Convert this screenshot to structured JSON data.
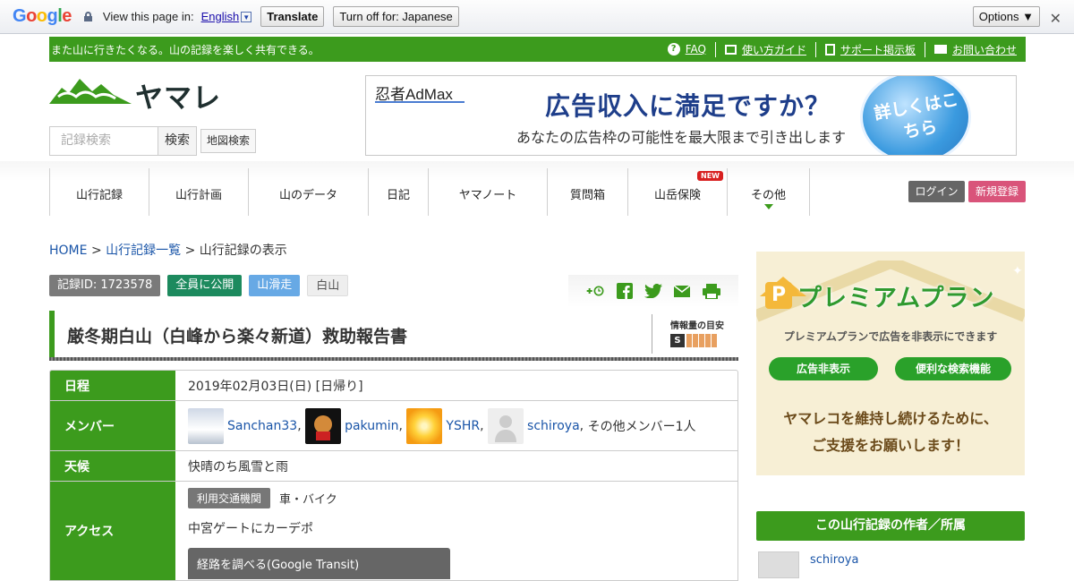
{
  "translate_bar": {
    "logo": "Google",
    "prompt": "View this page in:",
    "language": "English",
    "translate_label": "Translate",
    "turnoff_label": "Turn off for: Japanese",
    "options_label": "Options ▼",
    "close": "✕"
  },
  "header": {
    "tagline": "また山に行きたくなる。山の記録を楽しく共有できる。",
    "links": [
      "FAQ",
      "使い方ガイド",
      "サポート掲示板",
      "お問い合わせ"
    ],
    "logo_text": "ヤマレコ",
    "search_placeholder": "記録検索",
    "search_button": "検索",
    "map_search": "地図検索"
  },
  "ad_banner": {
    "brand": "忍者AdMax",
    "headline": "広告収入に満足ですか？",
    "subline": "あなたの広告枠の可能性を最大限まで引き出します",
    "cta": "詳しくはこちら"
  },
  "nav": {
    "items": [
      {
        "label": "山行記録"
      },
      {
        "label": "山行計画"
      },
      {
        "label": "山のデータ"
      },
      {
        "label": "日記"
      },
      {
        "label": "ヤマノート"
      },
      {
        "label": "質問箱"
      },
      {
        "label": "山岳保険",
        "badge": "NEW"
      },
      {
        "label": "その他"
      }
    ],
    "login": "ログイン",
    "signup": "新規登録"
  },
  "breadcrumb": {
    "home": "HOME",
    "list": "山行記録一覧",
    "sep": ">",
    "current": "山行記録の表示"
  },
  "record": {
    "tags": {
      "id": "記録ID: 1723578",
      "visibility": "全員に公開",
      "type": "山滑走",
      "mountain": "白山"
    },
    "title": "厳冬期白山（白峰から楽々新道）救助報告書",
    "info_level_label": "情報量の目安",
    "info_level_grade": "S",
    "rows": {
      "schedule_label": "日程",
      "schedule_value": "2019年02月03日(日) [日帰り]",
      "members_label": "メンバー",
      "members": [
        "Sanchan33",
        "pakumin",
        "YSHR",
        "schiroya"
      ],
      "members_extra": "その他メンバー1人",
      "weather_label": "天候",
      "weather_value": "快晴のち風雪と雨",
      "access_label": "アクセス",
      "transport_badge": "利用交通機関",
      "transport_value": "車・バイク",
      "access_note": "中宮ゲートにカーデポ",
      "route_button": "経路を調べる(Google Transit)"
    }
  },
  "sidebar": {
    "premium_title": "プレミアムプラン",
    "premium_sub": "プレミアムプランで広告を非表示にできます",
    "btn_hide_ads": "広告非表示",
    "btn_search": "便利な検索機能",
    "message_line1": "ヤマレコを維持し続けるために、",
    "message_line2": "ご支援をお願いします！",
    "author_header": "この山行記録の作者／所属",
    "author_name": "schiroya"
  },
  "colors": {
    "brand_green": "#3c9b1d",
    "signup_pink": "#d9547a",
    "link_blue": "#1a55a8"
  }
}
